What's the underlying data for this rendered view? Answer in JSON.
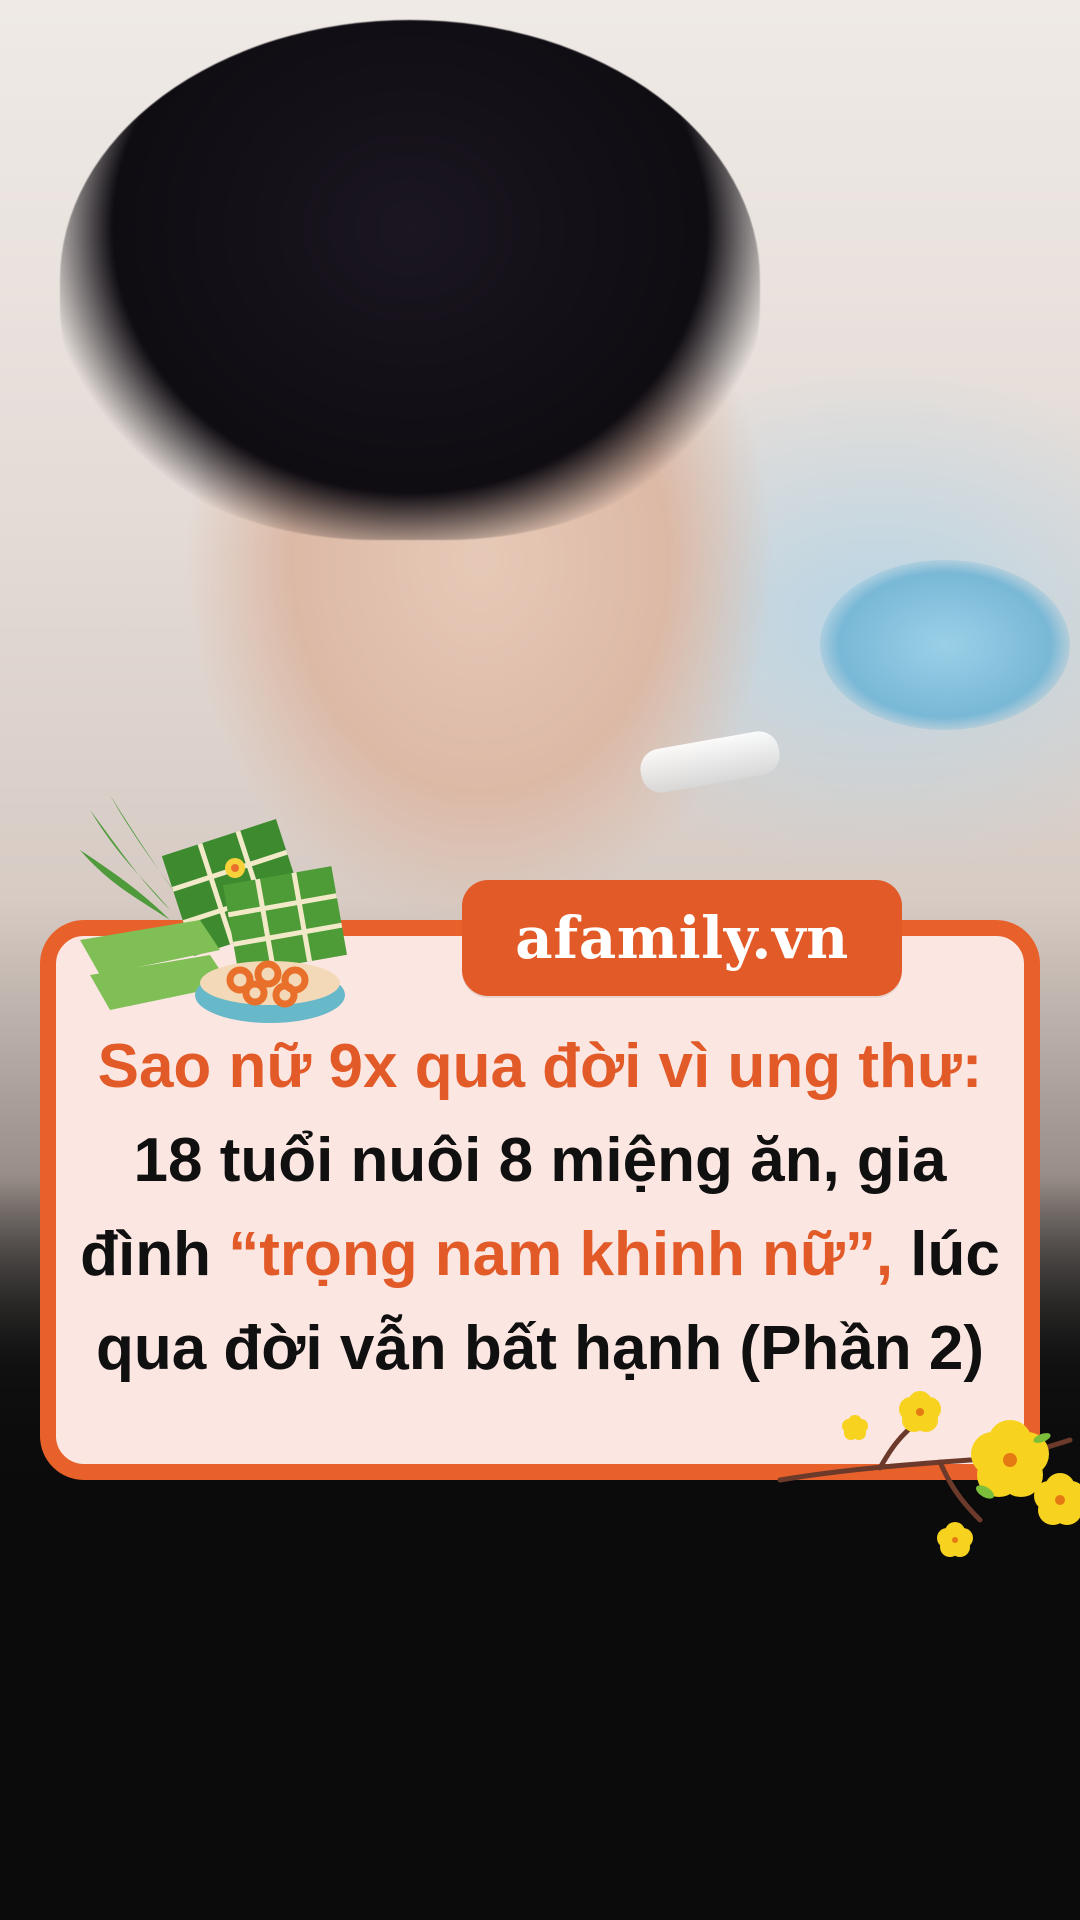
{
  "brand": {
    "label": "afamily.vn"
  },
  "headline": {
    "line1": "Sao nữ 9x qua đời vì ung thư:",
    "line2": "18 tuổi nuôi 8 miệng ăn, gia",
    "line3_pre": "đình ",
    "line3_accent": "“trọng nam khinh nữ”,",
    "line3_post": " lúc",
    "line4": "qua đời vẫn bất hạnh (Phần 2)"
  },
  "colors": {
    "accent": "#e15a27",
    "card_border": "#e8612a",
    "card_fill": "#fbe6e2",
    "headline_text": "#101010",
    "background": "#0b0b0b"
  },
  "icons": {
    "left_decoration": "banh-chung-and-mut-icon",
    "right_decoration": "apricot-blossom-icon"
  }
}
